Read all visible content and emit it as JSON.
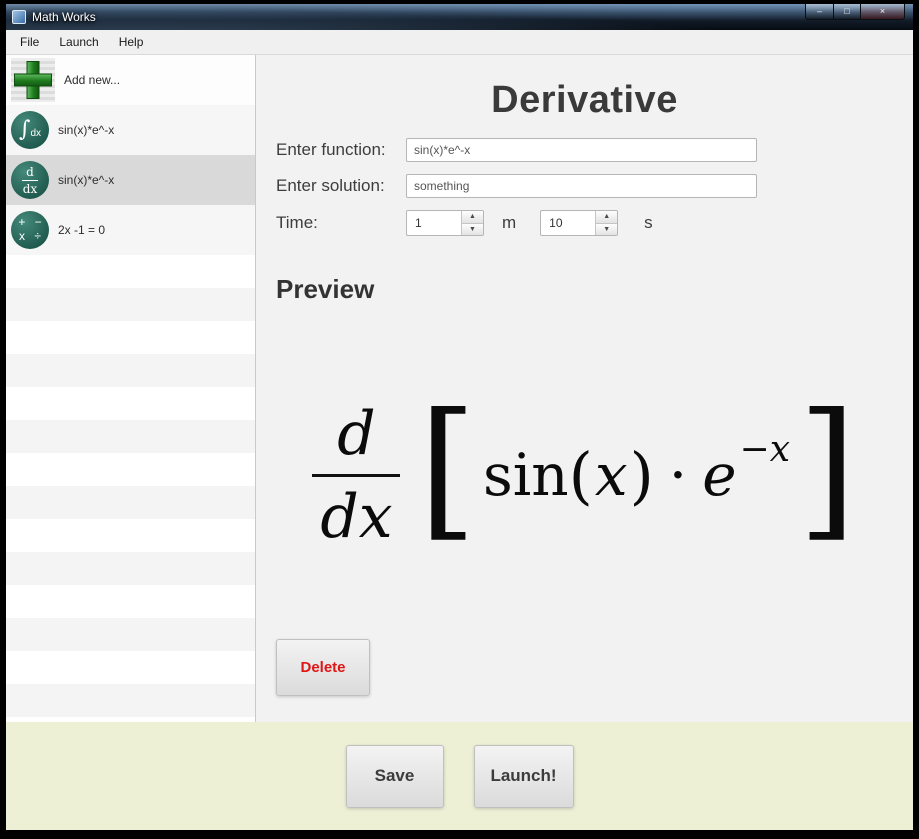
{
  "window": {
    "title": "Math Works",
    "controls": {
      "minimize": "–",
      "maximize": "□",
      "close": "×"
    }
  },
  "menu": {
    "items": [
      {
        "label": "File"
      },
      {
        "label": "Launch"
      },
      {
        "label": "Help"
      }
    ]
  },
  "sidebar": {
    "add_new_label": "Add new...",
    "items": [
      {
        "icon": "integral-icon",
        "icon_symbol": "∫",
        "icon_text": "dx",
        "label": "sin(x)*e^-x"
      },
      {
        "icon": "derivative-icon",
        "icon_num": "d",
        "icon_den": "dx",
        "label": "sin(x)*e^-x",
        "selected": true
      },
      {
        "icon": "operators-icon",
        "icon_row1": "+ −",
        "icon_row2": "x ÷",
        "label": "2x -1 = 0"
      }
    ]
  },
  "main": {
    "title": "Derivative",
    "function_label": "Enter function:",
    "function_value": "sin(x)*e^-x",
    "solution_label": "Enter solution:",
    "solution_value": "something",
    "time_label": "Time:",
    "minutes_value": "1",
    "minutes_unit": "m",
    "seconds_value": "10",
    "seconds_unit": "s",
    "preview_label": "Preview",
    "delete_label": "Delete",
    "formula": {
      "d": "d",
      "dx": "dx",
      "lbracket": "[",
      "rbracket": "]",
      "sin": "sin",
      "lparen": "(",
      "x": "x",
      "rparen": ")",
      "dot": "·",
      "e": "e",
      "exponent": "−x"
    }
  },
  "footer": {
    "save_label": "Save",
    "launch_label": "Launch!"
  },
  "icons": {
    "spinner_up": "▲",
    "spinner_down": "▼"
  },
  "colors": {
    "accent_green": "#1e7c1e",
    "icon_teal": "#2a6d60",
    "delete_red": "#e01515",
    "footer_cream": "#eef0d6"
  }
}
